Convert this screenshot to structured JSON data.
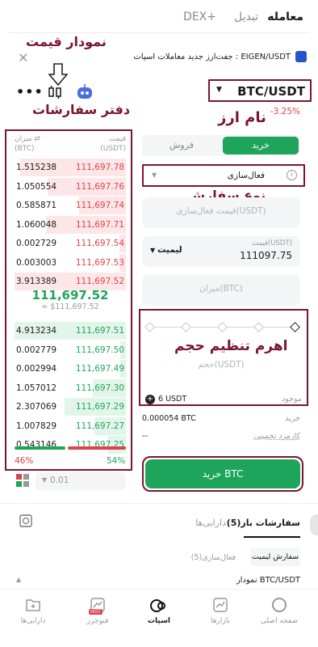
{
  "top_tabs": {
    "trade": "معامله",
    "convert": "تبدیل",
    "dex": "DEX+"
  },
  "banner": {
    "text": "جفت‌ارز جدید معاملات اسپات : EIGEN/USDT"
  },
  "pair": {
    "name": "BTC/USDT",
    "change": "-3.25%"
  },
  "annotations": {
    "price_chart": "نمودار قیمت",
    "order_book": "دفتر سفارشات",
    "asset_name": "نام ارز",
    "order_type": "نوع سفارش",
    "leverage": "اهرم تنظیم حجم"
  },
  "orderbook": {
    "header_qty": "میزان",
    "header_qty_unit": "(BTC)",
    "header_price": "قیمت",
    "header_price_unit": "(USDT)",
    "asks": [
      {
        "qty": "1.515238",
        "price": "111,697.78",
        "depth": 0.95
      },
      {
        "qty": "1.050554",
        "price": "111,697.76",
        "depth": 0.7
      },
      {
        "qty": "0.585871",
        "price": "111,697.74",
        "depth": 0.42
      },
      {
        "qty": "1.060048",
        "price": "111,697.71",
        "depth": 0.72
      },
      {
        "qty": "0.002729",
        "price": "111,697.54",
        "depth": 0.06
      },
      {
        "qty": "0.003003",
        "price": "111,697.53",
        "depth": 0.06
      },
      {
        "qty": "3.913389",
        "price": "111,697.52",
        "depth": 1.0
      }
    ],
    "last_price": "111,697.52",
    "last_price_fiat": "≈ $111,697.52",
    "bids": [
      {
        "qty": "4.913234",
        "price": "111,697.51",
        "depth": 1.0
      },
      {
        "qty": "0.002779",
        "price": "111,697.50",
        "depth": 0.05
      },
      {
        "qty": "0.002994",
        "price": "111,697.49",
        "depth": 0.05
      },
      {
        "qty": "1.057012",
        "price": "111,697.30",
        "depth": 0.3
      },
      {
        "qty": "2.307069",
        "price": "111,697.29",
        "depth": 0.55
      },
      {
        "qty": "1.007829",
        "price": "111,697.27",
        "depth": 0.28
      },
      {
        "qty": "0.543146",
        "price": "111,697.25",
        "depth": 0.16
      }
    ],
    "sell_percent": "46%",
    "buy_percent": "54%",
    "precision": "0.01"
  },
  "form": {
    "buy": "خرید",
    "sell": "فروش",
    "order_type": "فعال‌سازی",
    "trigger_placeholder": "قیمت فعال‌سازی(USDT)",
    "limit_label": "لیمیت",
    "price_label": "قیمت(USDT)",
    "price_value": "111097.75",
    "amount_placeholder": "میزان(BTC)",
    "total_placeholder": "حجم(USDT)",
    "available_label": "موجود",
    "available_value": "6 USDT",
    "buy_qty_label": "خرید",
    "buy_qty_value": "0.000054 BTC",
    "fee_label": "کارمزد تخمینی",
    "fee_value": "--",
    "submit": "خرید BTC"
  },
  "orders": {
    "open_tab": "سفارشات باز(5)",
    "assets_tab": "دارایی‌ها",
    "limit_filter": "سفارش لیمیت",
    "trigger_filter": "فعال‌سازی(5)",
    "chart_label": "نمودار BTC/USDT"
  },
  "bottom_nav": {
    "home": "صفحه اصلی",
    "markets": "بازارها",
    "spot": "اسپات",
    "futures": "فیوچرز",
    "hot": "HOT",
    "assets": "دارایی‌ها"
  }
}
